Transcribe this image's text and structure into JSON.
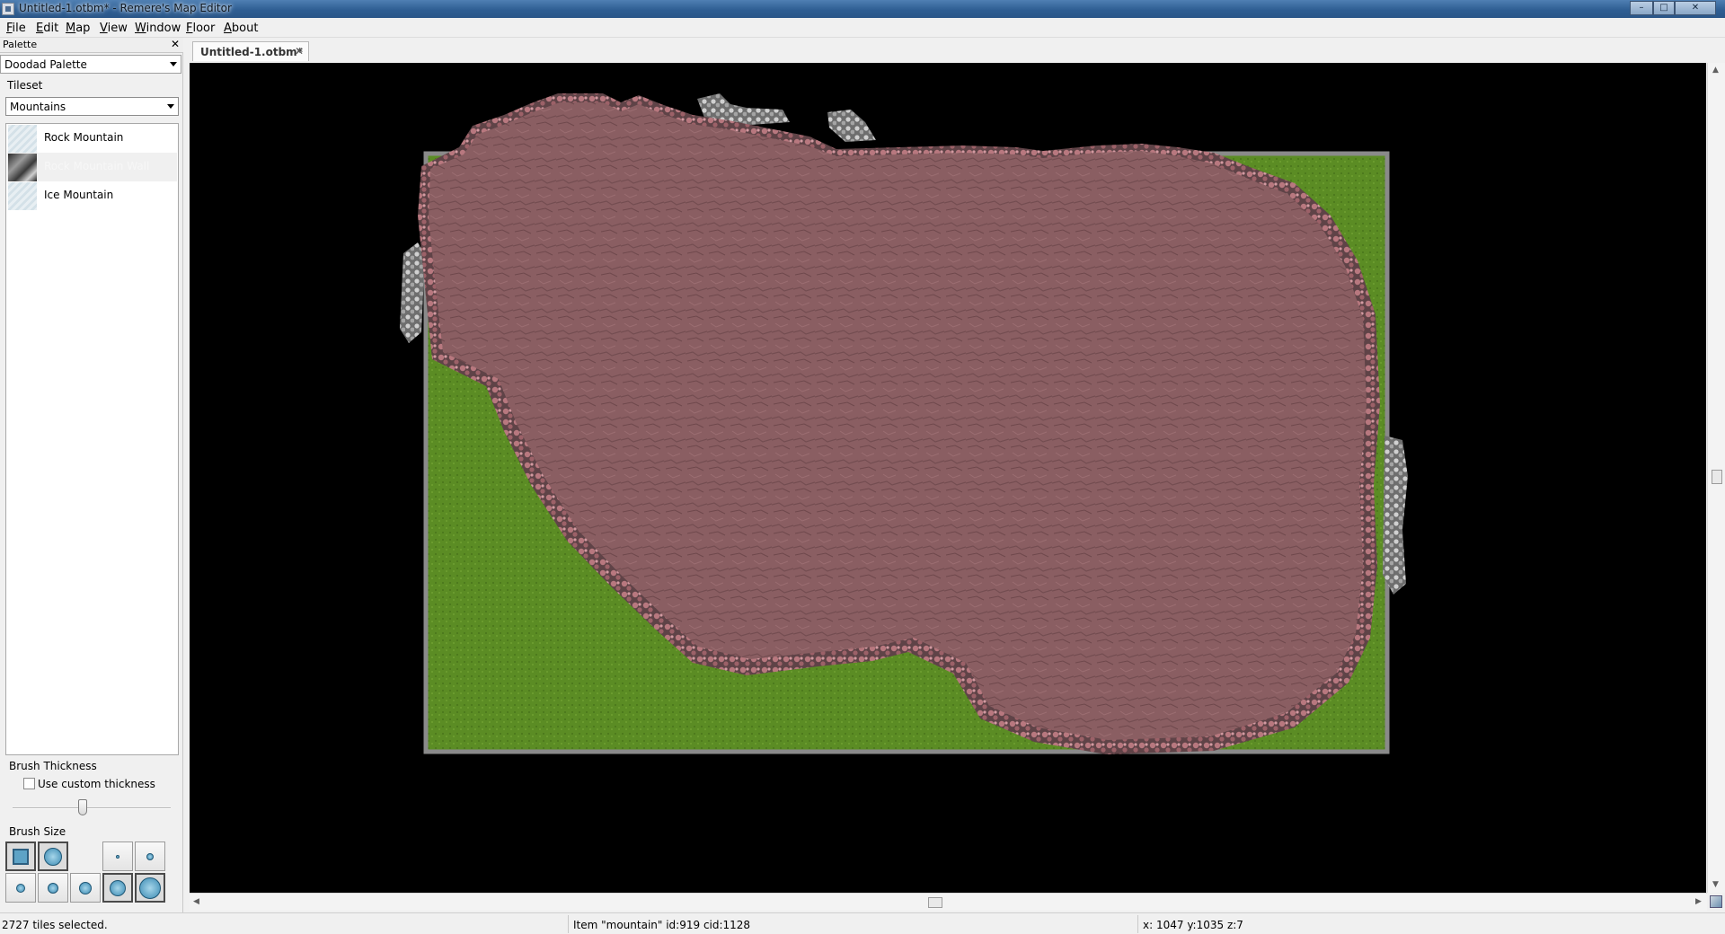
{
  "window": {
    "title": "Untitled-1.otbm* - Remere's Map Editor",
    "controls": {
      "minimize": "–",
      "maximize": "□",
      "close": "✕"
    }
  },
  "menu": [
    "File",
    "Edit",
    "Map",
    "View",
    "Window",
    "Floor",
    "About"
  ],
  "palette": {
    "header": "Palette",
    "close": "✕",
    "selected_palette": "Doodad Palette",
    "tileset_label": "Tileset",
    "tileset": "Mountains",
    "brushes": [
      "Rock Mountain",
      "Rock Mountain Wall",
      "Ice Mountain"
    ],
    "selected_brush": "Rock Mountain Wall",
    "brush_thickness_label": "Brush Thickness",
    "custom_thickness_label": "Use custom thickness",
    "custom_thickness_checked": false,
    "brush_size_label": "Brush Size"
  },
  "tabs": [
    {
      "label": "Untitled-1.otbm*",
      "close": "✕",
      "active": true
    }
  ],
  "status": {
    "selection": "2727 tiles selected.",
    "item": "Item \"mountain\" id:919 cid:1128",
    "position": "x: 1047 y:1035 z:7"
  },
  "colors": {
    "map_background": "#000000",
    "grass": "#5b8c24",
    "mountain": "#8a5e62",
    "rock_edge": "#a86c76",
    "stone_border": "#8a8a8a",
    "gray_rock": "#b8b8b8"
  },
  "icons": {
    "scroll_up": "▲",
    "scroll_down": "▼",
    "scroll_left": "◀",
    "scroll_right": "▶"
  }
}
